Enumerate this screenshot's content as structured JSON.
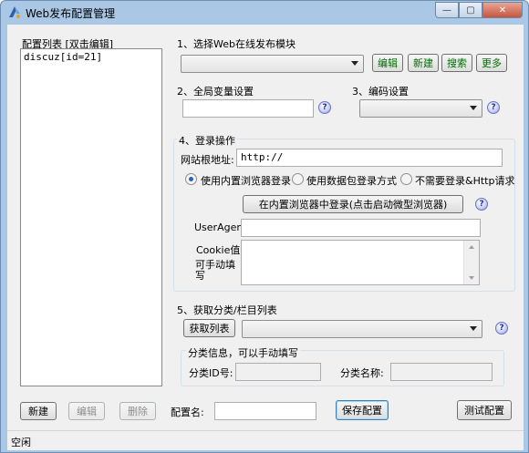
{
  "window": {
    "title": "Web发布配置管理"
  },
  "config_list": {
    "label": "配置列表 [双击编辑]",
    "items": [
      "discuz[id=21]"
    ]
  },
  "section1": {
    "title": "1、选择Web在线发布模块",
    "module_value": "",
    "edit_label": "编辑",
    "new_label": "新建",
    "search_label": "搜索",
    "more_label": "更多"
  },
  "section2": {
    "title": "2、全局变量设置",
    "value": ""
  },
  "section3": {
    "title": "3、编码设置",
    "value": ""
  },
  "section4": {
    "title": "4、登录操作",
    "root_label": "网站根地址:",
    "root_value": "http://",
    "radio_builtin": "使用内置浏览器登录",
    "radio_packet": "使用数据包登录方式",
    "radio_none": "不需要登录&Http请求",
    "login_button": "在内置浏览器中登录(点击启动微型浏览器)",
    "useragent_label": "UserAgent",
    "useragent_value": "",
    "cookie_label": "Cookie值:",
    "cookie_hint": "可手动填写",
    "cookie_value": ""
  },
  "section5": {
    "title": "5、获取分类/栏目列表",
    "get_list_label": "获取列表",
    "category_value": "",
    "info_label": "分类信息，可以手动填写",
    "id_label": "分类ID号:",
    "id_value": "",
    "name_label": "分类名称:",
    "name_value": ""
  },
  "bottom": {
    "new_label": "新建",
    "edit_label": "编辑",
    "delete_label": "删除",
    "config_name_label": "配置名:",
    "config_name_value": "",
    "save_label": "保存配置",
    "test_label": "测试配置"
  },
  "help_glyph": "?",
  "status": {
    "text": "空闲"
  },
  "colors": {
    "title_bar": "#aac8e6",
    "client": "#f0f0f0",
    "green_button_text": "#006b00"
  }
}
